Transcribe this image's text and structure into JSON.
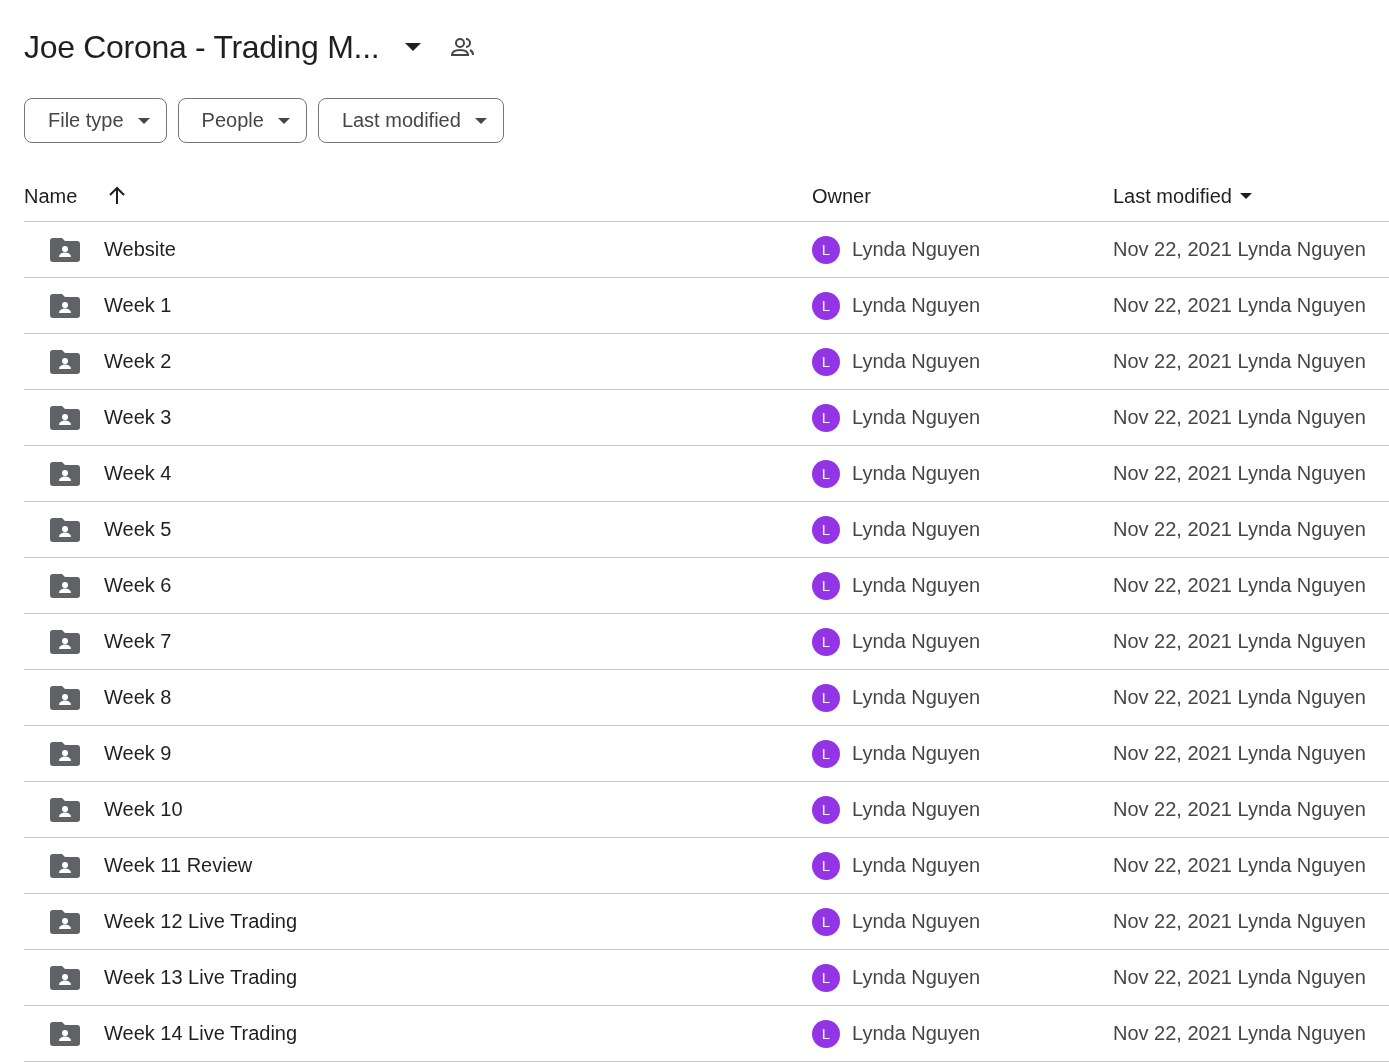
{
  "title": "Joe Corona - Trading M...",
  "filters": [
    {
      "label": "File type"
    },
    {
      "label": "People"
    },
    {
      "label": "Last modified"
    }
  ],
  "table": {
    "columns": [
      {
        "label": "Name",
        "kind": "arrow"
      },
      {
        "label": "Owner",
        "kind": "plain"
      },
      {
        "label": "Last modified",
        "kind": "caret"
      }
    ],
    "rows": [
      {
        "name": "Website",
        "owner": "Lynda Nguyen",
        "avatar": "L",
        "modified": "Nov 22, 2021 Lynda Nguyen"
      },
      {
        "name": "Week 1",
        "owner": "Lynda Nguyen",
        "avatar": "L",
        "modified": "Nov 22, 2021 Lynda Nguyen"
      },
      {
        "name": "Week 2",
        "owner": "Lynda Nguyen",
        "avatar": "L",
        "modified": "Nov 22, 2021 Lynda Nguyen"
      },
      {
        "name": "Week 3",
        "owner": "Lynda Nguyen",
        "avatar": "L",
        "modified": "Nov 22, 2021 Lynda Nguyen"
      },
      {
        "name": "Week 4",
        "owner": "Lynda Nguyen",
        "avatar": "L",
        "modified": "Nov 22, 2021 Lynda Nguyen"
      },
      {
        "name": "Week 5",
        "owner": "Lynda Nguyen",
        "avatar": "L",
        "modified": "Nov 22, 2021 Lynda Nguyen"
      },
      {
        "name": "Week 6",
        "owner": "Lynda Nguyen",
        "avatar": "L",
        "modified": "Nov 22, 2021 Lynda Nguyen"
      },
      {
        "name": "Week 7",
        "owner": "Lynda Nguyen",
        "avatar": "L",
        "modified": "Nov 22, 2021 Lynda Nguyen"
      },
      {
        "name": "Week 8",
        "owner": "Lynda Nguyen",
        "avatar": "L",
        "modified": "Nov 22, 2021 Lynda Nguyen"
      },
      {
        "name": "Week 9",
        "owner": "Lynda Nguyen",
        "avatar": "L",
        "modified": "Nov 22, 2021 Lynda Nguyen"
      },
      {
        "name": "Week 10",
        "owner": "Lynda Nguyen",
        "avatar": "L",
        "modified": "Nov 22, 2021 Lynda Nguyen"
      },
      {
        "name": "Week 11 Review",
        "owner": "Lynda Nguyen",
        "avatar": "L",
        "modified": "Nov 22, 2021 Lynda Nguyen"
      },
      {
        "name": "Week 12 Live Trading",
        "owner": "Lynda Nguyen",
        "avatar": "L",
        "modified": "Nov 22, 2021 Lynda Nguyen"
      },
      {
        "name": "Week 13 Live Trading",
        "owner": "Lynda Nguyen",
        "avatar": "L",
        "modified": "Nov 22, 2021 Lynda Nguyen"
      },
      {
        "name": "Week 14 Live Trading",
        "owner": "Lynda Nguyen",
        "avatar": "L",
        "modified": "Nov 22, 2021 Lynda Nguyen"
      }
    ]
  }
}
